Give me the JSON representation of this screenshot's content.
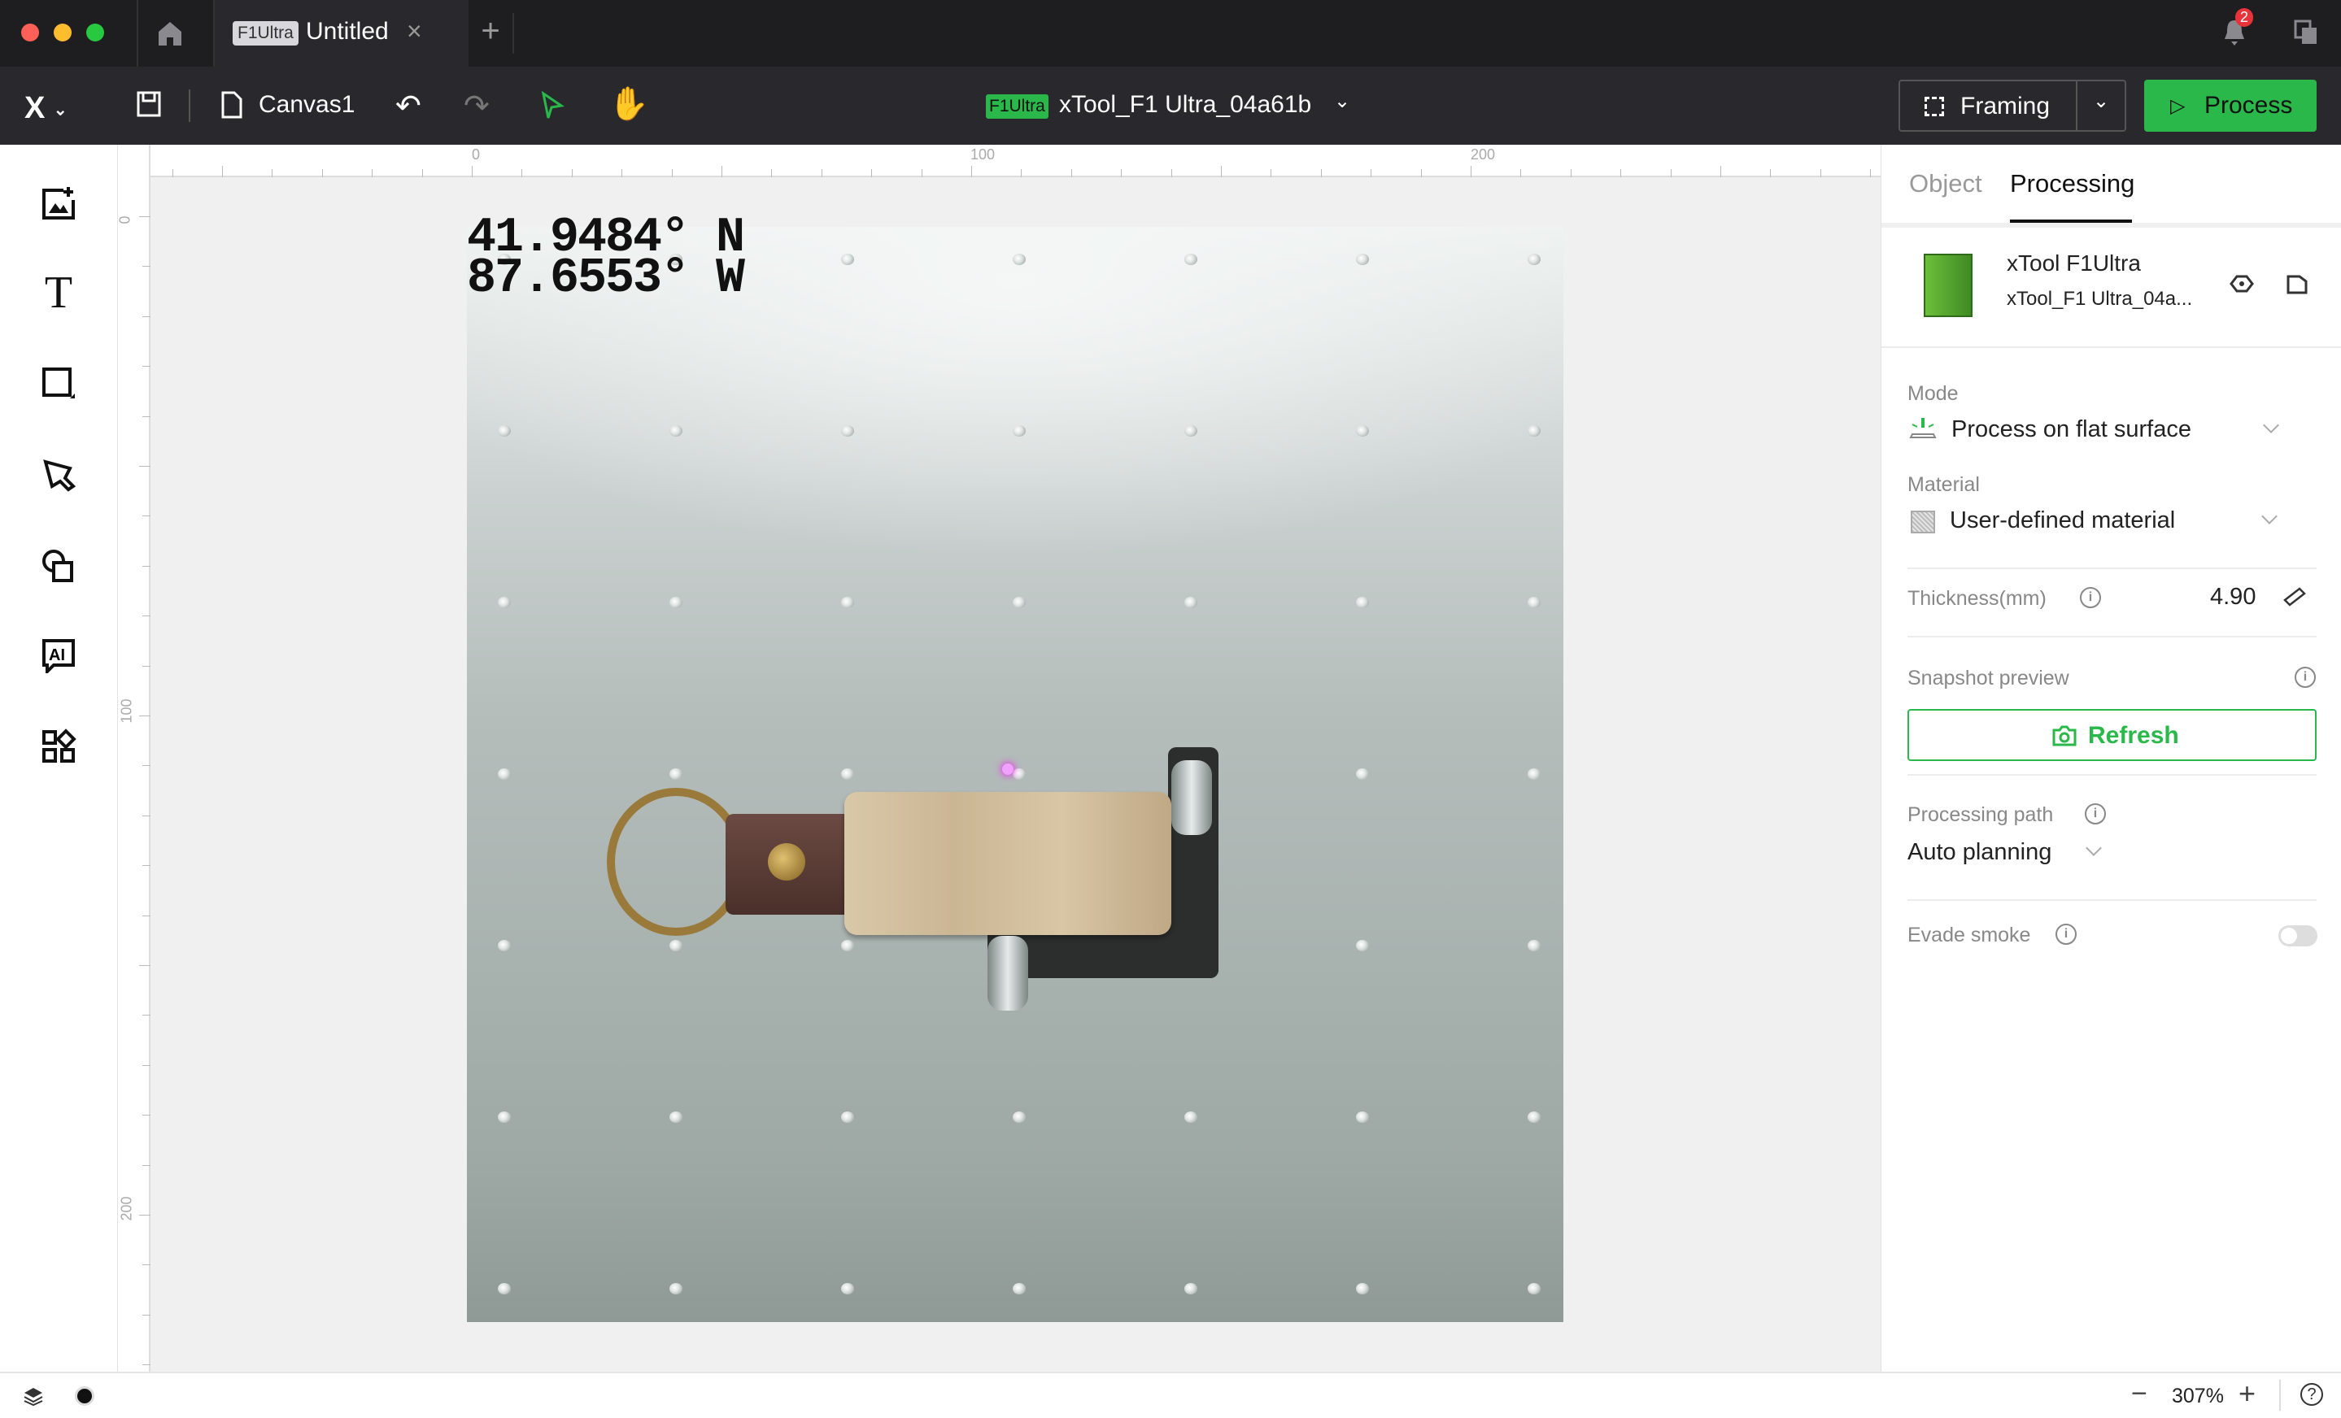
{
  "titlebar": {
    "tab": {
      "badge": "F1Ultra",
      "title": "Untitled"
    },
    "notification_count": "2"
  },
  "toolbar": {
    "canvas_name": "Canvas1",
    "device": {
      "badge": "F1Ultra",
      "name": "xTool_F1 Ultra_04a61b"
    },
    "framing_label": "Framing",
    "process_label": "Process"
  },
  "ruler": {
    "h_labels": [
      "0",
      "100",
      "200"
    ],
    "v_labels": [
      "0",
      "100",
      "200"
    ]
  },
  "canvas": {
    "coord_line1": "41.9484° N",
    "coord_line2": "87.6553° W"
  },
  "panel": {
    "tabs": [
      {
        "label": "Object",
        "active": false
      },
      {
        "label": "Processing",
        "active": true
      }
    ],
    "device": {
      "model": "xTool F1Ultra",
      "name": "xTool_F1 Ultra_04a..."
    },
    "mode": {
      "label": "Mode",
      "value": "Process on flat surface"
    },
    "material": {
      "label": "Material",
      "value": "User-defined material"
    },
    "thickness": {
      "label": "Thickness(mm)",
      "value": "4.90"
    },
    "snapshot": {
      "label": "Snapshot preview",
      "button": "Refresh"
    },
    "path": {
      "label": "Processing path",
      "value": "Auto planning"
    },
    "evade": {
      "label": "Evade smoke",
      "enabled": false
    }
  },
  "statusbar": {
    "zoom": "307%"
  },
  "colors": {
    "accent": "#2ab84a",
    "dark": "#29292d"
  }
}
